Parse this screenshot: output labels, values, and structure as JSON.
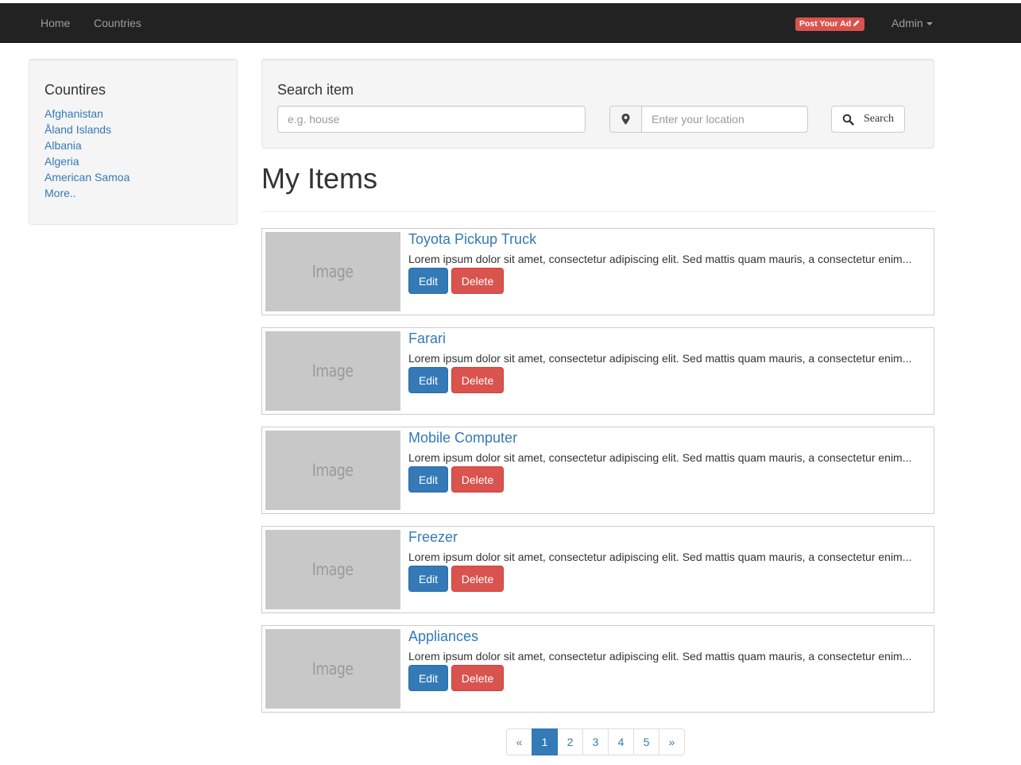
{
  "navbar": {
    "home": "Home",
    "countries": "Countries",
    "post_ad": "Post Your Ad",
    "admin": "Admin"
  },
  "sidebar": {
    "title": "Countires",
    "countries": [
      "Afghanistan",
      "Åland Islands",
      "Albania",
      "Algeria",
      "American Samoa"
    ],
    "more": "More.."
  },
  "search": {
    "title": "Search item",
    "item_placeholder": "e.g. house",
    "location_placeholder": "Enter your location",
    "button": "Search"
  },
  "page": {
    "title": "My Items"
  },
  "items": [
    {
      "title": "Toyota Pickup Truck",
      "image": "Image",
      "desc": "Lorem ipsum dolor sit amet, consectetur adipiscing elit. Sed mattis quam mauris, a consectetur enim...",
      "edit": "Edit",
      "delete": "Delete"
    },
    {
      "title": "Farari",
      "image": "Image",
      "desc": "Lorem ipsum dolor sit amet, consectetur adipiscing elit. Sed mattis quam mauris, a consectetur enim...",
      "edit": "Edit",
      "delete": "Delete"
    },
    {
      "title": "Mobile Computer",
      "image": "Image",
      "desc": "Lorem ipsum dolor sit amet, consectetur adipiscing elit. Sed mattis quam mauris, a consectetur enim...",
      "edit": "Edit",
      "delete": "Delete"
    },
    {
      "title": "Freezer",
      "image": "Image",
      "desc": "Lorem ipsum dolor sit amet, consectetur adipiscing elit. Sed mattis quam mauris, a consectetur enim...",
      "edit": "Edit",
      "delete": "Delete"
    },
    {
      "title": "Appliances",
      "image": "Image",
      "desc": "Lorem ipsum dolor sit amet, consectetur adipiscing elit. Sed mattis quam mauris, a consectetur enim...",
      "edit": "Edit",
      "delete": "Delete"
    }
  ],
  "pagination": {
    "prev": "«",
    "pages": [
      "1",
      "2",
      "3",
      "4",
      "5"
    ],
    "active": "1",
    "next": "»"
  },
  "colors": {
    "navbar": "#222222",
    "primary": "#337ab7",
    "danger": "#d9534f"
  }
}
